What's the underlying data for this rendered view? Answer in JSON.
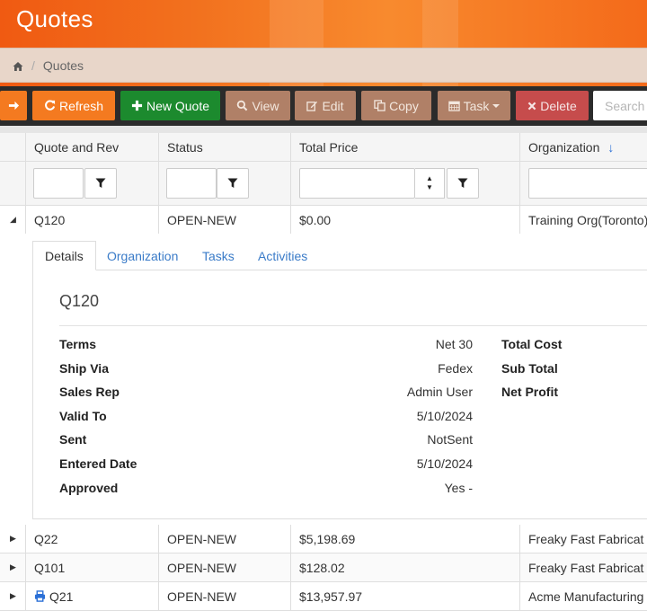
{
  "header": {
    "title": "Quotes",
    "breadcrumb": [
      "Quotes"
    ],
    "colors": {
      "brand": "#f47a20",
      "toolbar": "#2b2b2b",
      "link": "#3a7bc8"
    }
  },
  "toolbar": {
    "refresh": "Refresh",
    "new_quote": "New Quote",
    "view": "View",
    "edit": "Edit",
    "copy": "Copy",
    "task": "Task",
    "delete": "Delete",
    "search_placeholder": "Search"
  },
  "grid": {
    "columns": [
      "Quote and Rev",
      "Status",
      "Total Price",
      "Organization"
    ],
    "sort_column": "Organization",
    "sort_direction": "descending",
    "rows": [
      {
        "quote": "Q120",
        "status": "OPEN-NEW",
        "total": "$0.00",
        "org": "Training Org(Toronto)",
        "expanded": true
      },
      {
        "quote": "Q22",
        "status": "OPEN-NEW",
        "total": "$5,198.69",
        "org": "Freaky Fast Fabricat"
      },
      {
        "quote": "Q101",
        "status": "OPEN-NEW",
        "total": "$128.02",
        "org": "Freaky Fast Fabricat"
      },
      {
        "quote": "Q21",
        "status": "OPEN-NEW",
        "total": "$13,957.97",
        "org": "Acme Manufacturing",
        "icon": "print-icon"
      }
    ]
  },
  "detail": {
    "tabs": [
      "Details",
      "Organization",
      "Tasks",
      "Activities"
    ],
    "active_tab": "Details",
    "title": "Q120",
    "fields": [
      {
        "label": "Terms",
        "value": "Net 30"
      },
      {
        "label": "Ship Via",
        "value": "Fedex"
      },
      {
        "label": "Sales Rep",
        "value": "Admin User"
      },
      {
        "label": "Valid To",
        "value": "5/10/2024"
      },
      {
        "label": "Sent",
        "value": "NotSent"
      },
      {
        "label": "Entered Date",
        "value": "5/10/2024"
      },
      {
        "label": "Approved",
        "value": "Yes -"
      }
    ],
    "summary_labels": [
      "Total Cost",
      "Sub Total",
      "Net Profit"
    ]
  }
}
